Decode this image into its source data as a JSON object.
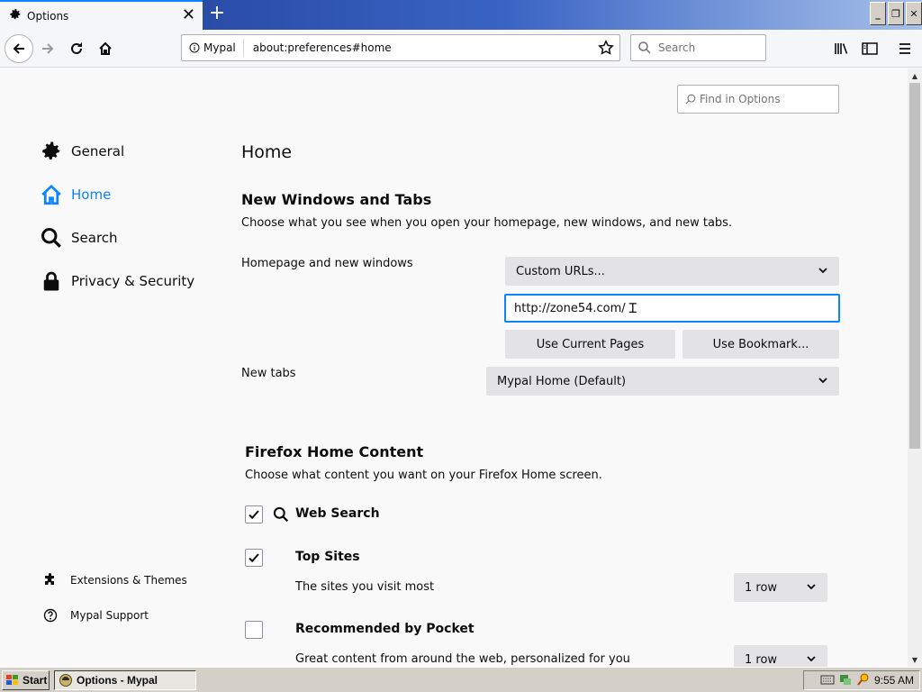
{
  "tab": {
    "title": "Options",
    "close_glyph": "✕"
  },
  "newtab_glyph": "+",
  "window_buttons": [
    "_",
    "❐",
    "✕"
  ],
  "navbar": {
    "identity_label": "Mypal",
    "url": "about:preferences#home",
    "search_placeholder": "Search"
  },
  "find_placeholder": "Find in Options",
  "sidebar": {
    "items": [
      {
        "label": "General",
        "icon": "gear-icon"
      },
      {
        "label": "Home",
        "icon": "home-icon",
        "selected": true
      },
      {
        "label": "Search",
        "icon": "search-icon"
      },
      {
        "label": "Privacy & Security",
        "icon": "lock-icon"
      }
    ],
    "footer": [
      {
        "label": "Extensions & Themes",
        "icon": "puzzle-icon"
      },
      {
        "label": "Mypal Support",
        "icon": "help-icon"
      }
    ]
  },
  "main": {
    "title": "Home",
    "section1": {
      "heading": "New Windows and Tabs",
      "description": "Choose what you see when you open your homepage, new windows, and new tabs.",
      "homepage_label": "Homepage and new windows",
      "homepage_select": "Custom URLs...",
      "homepage_url": "http://zone54.com/",
      "use_current_pages": "Use Current Pages",
      "use_bookmark": "Use Bookmark...",
      "newtabs_label": "New tabs",
      "newtabs_select": "Mypal Home (Default)"
    },
    "section2": {
      "heading": "Firefox Home Content",
      "description": "Choose what content you want on your Firefox Home screen.",
      "options": [
        {
          "label": "Web Search",
          "checked": true
        },
        {
          "label": "Top Sites",
          "checked": true,
          "sub": "The sites you visit most",
          "rows": "1 row"
        },
        {
          "label": "Recommended by Pocket",
          "checked": false,
          "sub": "Great content from around the web, personalized for you",
          "rows": "1 row"
        }
      ]
    }
  },
  "taskbar": {
    "start": "Start",
    "task": "Options - Mypal",
    "clock": "9:55 AM"
  },
  "colors": {
    "accent": "#0a84ff",
    "titlebar": "#1d3c93"
  }
}
